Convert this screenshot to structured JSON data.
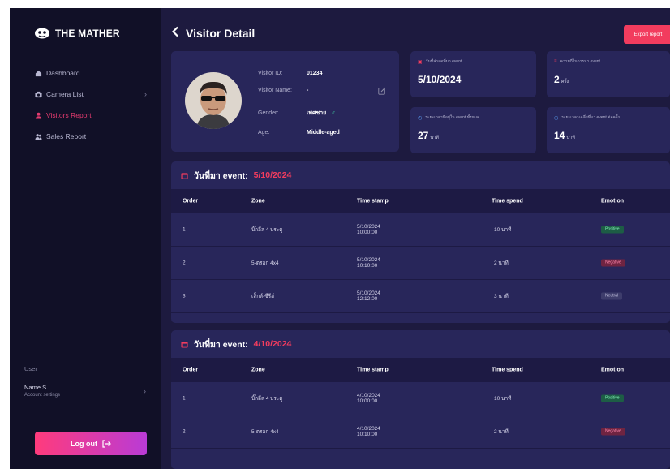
{
  "brand": {
    "name": "THE MATHER"
  },
  "sidebar": {
    "items": [
      {
        "label": "Dashboard",
        "icon": "home-icon",
        "active": false
      },
      {
        "label": "Camera List",
        "icon": "camera-icon",
        "active": false
      },
      {
        "label": "Visitors Report",
        "icon": "user-icon",
        "active": true
      },
      {
        "label": "Sales Report",
        "icon": "users-icon",
        "active": false
      }
    ],
    "user_caption": "User",
    "user_name": "Name.S",
    "account_settings": "Account settings",
    "logout_label": "Log out"
  },
  "header": {
    "title": "Visitor Detail",
    "export_label": "Export report"
  },
  "profile": {
    "visitor_id_label": "Visitor ID:",
    "visitor_id": "01234",
    "visitor_name_label": "Visitor Name:",
    "visitor_name": "-",
    "gender_label": "Gender:",
    "gender": "เพศชาย",
    "age_label": "Age:",
    "age": "Middle-aged"
  },
  "stats": [
    {
      "label": "วันที่ล่าสุดที่มา event",
      "value": "5/10/2024",
      "unit": ""
    },
    {
      "label": "ความถี่ในการมา event",
      "value": "2",
      "unit": "ครั้ง"
    },
    {
      "label": "ระยะเวลาที่อยู่ใน event ทั้งหมด",
      "value": "27",
      "unit": "นาที"
    },
    {
      "label": "ระยะเวลาเฉลี่ยที่มา event ต่อครั้ง",
      "value": "14",
      "unit": "นาที"
    }
  ],
  "table_headers": [
    "Order",
    "Zone",
    "Time stamp",
    "Time spend",
    "Emotion"
  ],
  "sections": [
    {
      "title": "วันที่มา event:",
      "date": "5/10/2024",
      "rows": [
        {
          "order": "1",
          "zone": "บิ๊กอีส 4 ประตู",
          "date": "5/10/2024",
          "time": "10:00:00",
          "spend": "10 นาที",
          "emotion": "Positive",
          "emotion_class": "b-pos"
        },
        {
          "order": "2",
          "zone": "5-ตรอก 4x4",
          "date": "5/10/2024",
          "time": "10:10:00",
          "spend": "2 นาที",
          "emotion": "Negative",
          "emotion_class": "b-neg"
        },
        {
          "order": "3",
          "zone": "เล็กส์-ซีรีส์",
          "date": "5/10/2024",
          "time": "12:12:00",
          "spend": "3 นาที",
          "emotion": "Neutral",
          "emotion_class": "b-neu"
        }
      ]
    },
    {
      "title": "วันที่มา event:",
      "date": "4/10/2024",
      "rows": [
        {
          "order": "1",
          "zone": "บิ๊กอีส 4 ประตู",
          "date": "4/10/2024",
          "time": "10:00:00",
          "spend": "10 นาที",
          "emotion": "Positive",
          "emotion_class": "b-pos"
        },
        {
          "order": "2",
          "zone": "5-ตรอก 4x4",
          "date": "4/10/2024",
          "time": "10:10:00",
          "spend": "2 นาที",
          "emotion": "Negative",
          "emotion_class": "b-neg"
        }
      ]
    }
  ],
  "colors": {
    "accent": "#f23c5e",
    "background": "#1d1a3f",
    "sidebar": "#111027",
    "card": "#28265a",
    "positive": "#1d5d45",
    "negative": "#6f2441"
  }
}
